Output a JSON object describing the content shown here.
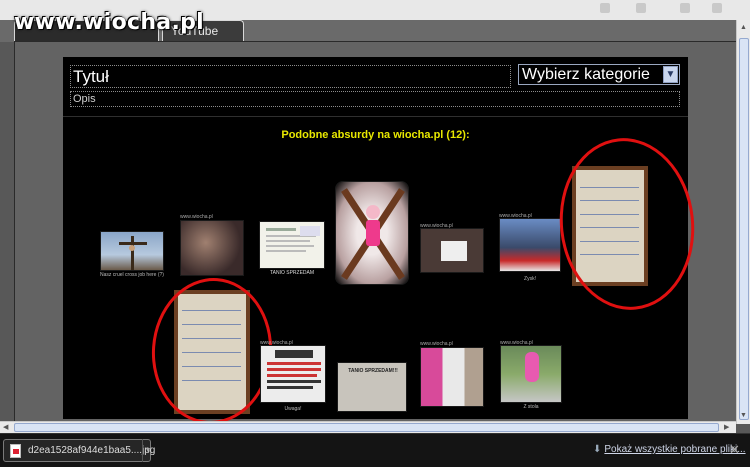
{
  "watermark": "www.wiocha.pl",
  "tabs": [
    {
      "label": ""
    },
    {
      "label": "YouTube"
    }
  ],
  "form": {
    "title_value": "Tytuł",
    "category_selected": "Wybierz kategorie",
    "description_value": "Opis"
  },
  "similar": {
    "heading": "Podobne absurdy na wiocha.pl (12):",
    "row1": [
      {
        "name": "crucifix",
        "caption": "Nasz cruel cross job here (?)"
      },
      {
        "name": "crowd",
        "tag": "www.wiocha.pl"
      },
      {
        "name": "document",
        "caption": "TANIO SPRZEDAM"
      },
      {
        "name": "pink-figure"
      },
      {
        "name": "sign",
        "tag": "www.wiocha.pl"
      },
      {
        "name": "tv-news",
        "tag": "www.wiocha.pl",
        "caption": "Zysk!"
      },
      {
        "name": "note-highlight"
      }
    ],
    "row2": [
      {
        "name": "note-highlight"
      },
      {
        "name": "warning",
        "tag": "www.wiocha.pl",
        "caption": "Uwaga!"
      },
      {
        "name": "tanio",
        "caption": "TANIO SPRZEDAM!!!"
      },
      {
        "name": "collage",
        "tag": "www.wiocha.pl"
      },
      {
        "name": "pink-photo",
        "tag": "www.wiocha.pl",
        "caption": "Z stola"
      }
    ]
  },
  "downloads": {
    "file_name": "d2ea1528af944e1baa5....jpg",
    "show_all": "Pokaż wszystkie pobrane pliki...",
    "close_glyph": "✕"
  },
  "icons": [
    "file-image-icon",
    "download-arrow-icon",
    "close-icon",
    "dropdown-arrow-icon"
  ],
  "colors": {
    "heading": "#e8e800",
    "highlight": "#e01010",
    "panel": "#000000"
  }
}
